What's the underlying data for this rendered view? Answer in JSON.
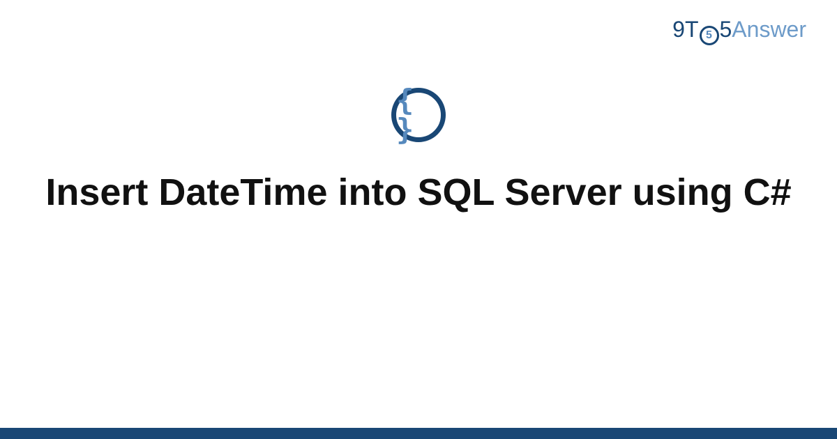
{
  "brand": {
    "part1": "9",
    "part2": "T",
    "clock_inner": "5",
    "part3": "5",
    "part4": "Answer"
  },
  "icon": {
    "glyph": "{ }",
    "name": "code-braces-icon"
  },
  "title": "Insert DateTime into SQL Server using C#",
  "colors": {
    "primary": "#194775",
    "accent": "#5689bd"
  }
}
